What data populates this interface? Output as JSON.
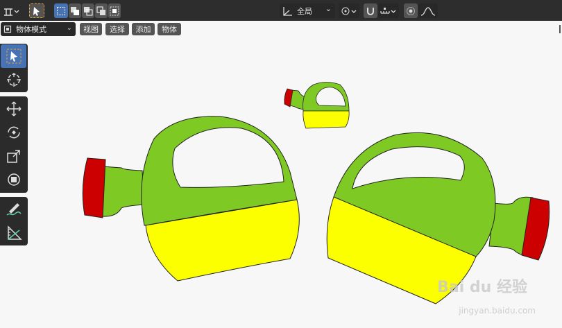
{
  "header": {
    "transform_orientation": "全局",
    "chevron": "⌄"
  },
  "mode_selector": {
    "label": "物体模式"
  },
  "menu": {
    "items": [
      {
        "label": "视图"
      },
      {
        "label": "选择"
      },
      {
        "label": "添加"
      },
      {
        "label": "物体"
      }
    ]
  },
  "toolbar": {
    "tools": [
      {
        "name": "select-box",
        "active": true
      },
      {
        "name": "cursor"
      },
      {
        "name": "move"
      },
      {
        "name": "rotate"
      },
      {
        "name": "scale"
      },
      {
        "name": "transform"
      },
      {
        "name": "annotate"
      },
      {
        "name": "measure"
      }
    ]
  },
  "watermark": {
    "brand": "Bai du 经验",
    "url": "jingyan.baidu.com"
  },
  "colors": {
    "body_green": "#7ec924",
    "band_yellow": "#fbff00",
    "cap_red": "#cc0000",
    "active_tool": "#4772b3",
    "header_bg": "#2d2d2d",
    "viewport_bg": "#f7f7f7"
  }
}
